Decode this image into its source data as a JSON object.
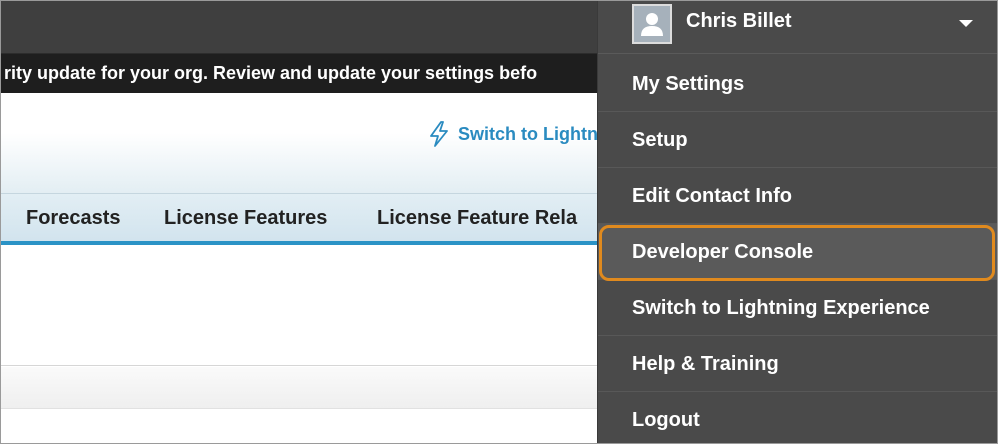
{
  "banner": {
    "text": "rity update for your org. Review and update your settings befo"
  },
  "header": {
    "switch_link": "Switch to Lightn"
  },
  "tabs": [
    {
      "label": "Forecasts"
    },
    {
      "label": "License Features"
    },
    {
      "label": "License Feature Rela"
    }
  ],
  "user_menu": {
    "user_name": "Chris Billet",
    "items": [
      {
        "label": "My Settings"
      },
      {
        "label": "Setup"
      },
      {
        "label": "Edit Contact Info"
      },
      {
        "label": "Developer Console"
      },
      {
        "label": "Switch to Lightning Experience"
      },
      {
        "label": "Help & Training"
      },
      {
        "label": "Logout"
      }
    ],
    "highlighted_item": "Developer Console",
    "highlight_color": "#e08a1e"
  },
  "colors": {
    "accent_blue": "#2b93c6",
    "link_blue": "#2a8bc0",
    "menu_bg": "#4a4a4a",
    "banner_bg": "#1e1e1e"
  }
}
